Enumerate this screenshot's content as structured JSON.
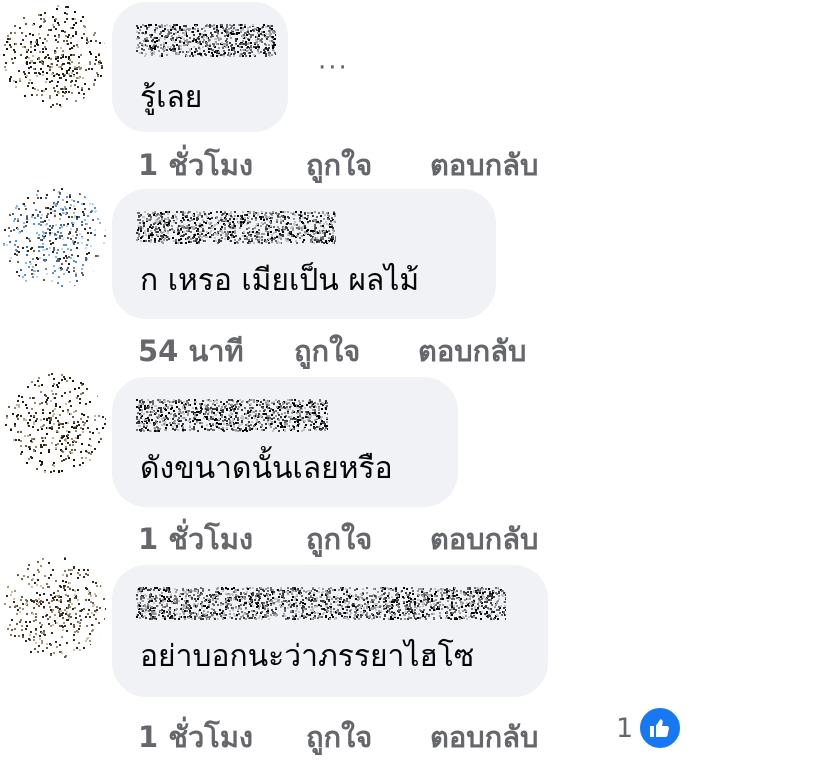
{
  "comments": [
    {
      "author_name": "",
      "text": "รู้เลย",
      "time": "1 ชั่วโมง",
      "like_label": "ถูกใจ",
      "reply_label": "ตอบกลับ"
    },
    {
      "author_name": "",
      "text": "ก เหรอ เมียเป็น ผลไม้",
      "time": "54 นาที",
      "like_label": "ถูกใจ",
      "reply_label": "ตอบกลับ"
    },
    {
      "author_name": "",
      "text": "ดังขนาดนั้นเลยหรือ",
      "time": "1 ชั่วโมง",
      "like_label": "ถูกใจ",
      "reply_label": "ตอบกลับ"
    },
    {
      "author_name": "",
      "text": "อย่าบอกนะว่าภรรยาไฮโซ",
      "time": "1 ชั่วโมง",
      "like_label": "ถูกใจ",
      "reply_label": "ตอบกลับ",
      "reaction_count": "1",
      "reaction_icon": "like-icon"
    }
  ],
  "more_options_label": "···",
  "colors": {
    "bubble_bg": "#f0f2f5",
    "meta_text": "#65676b",
    "like_blue": "#1877f2"
  }
}
